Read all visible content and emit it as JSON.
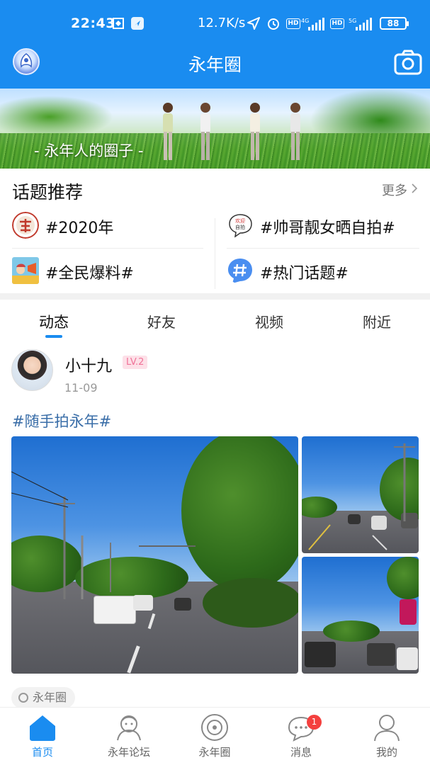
{
  "status_bar": {
    "time": "22:43",
    "network_speed": "12.7K/s",
    "battery": "88",
    "signal_labels": [
      "4G",
      "5G"
    ],
    "hd_label": "HD"
  },
  "header": {
    "title": "永年圈",
    "logo_icon": "app-logo-icon",
    "camera_icon": "camera-icon"
  },
  "banner": {
    "caption": "- 永年人的圈子 -"
  },
  "topics": {
    "title": "话题推荐",
    "more_label": "更多",
    "items": [
      {
        "label": "#2020年",
        "icon": "topic-2020-icon"
      },
      {
        "label": "#帅哥靓女晒自拍#",
        "icon": "topic-selfie-icon"
      },
      {
        "label": "#全民爆料#",
        "icon": "topic-report-icon"
      },
      {
        "label": "#热门话题#",
        "icon": "topic-hot-icon"
      }
    ]
  },
  "tabs": [
    {
      "label": "动态",
      "active": true
    },
    {
      "label": "好友",
      "active": false
    },
    {
      "label": "视频",
      "active": false
    },
    {
      "label": "附近",
      "active": false
    }
  ],
  "post": {
    "username": "小十九",
    "level": "LV.2",
    "date": "11-09",
    "hashtag": "#随手拍永年#",
    "circle_tag": "永年圈"
  },
  "bottom_nav": [
    {
      "label": "首页",
      "icon": "home-icon",
      "active": true
    },
    {
      "label": "永年论坛",
      "icon": "forum-icon",
      "active": false
    },
    {
      "label": "永年圈",
      "icon": "circle-icon",
      "active": false
    },
    {
      "label": "消息",
      "icon": "message-icon",
      "active": false,
      "badge": "1"
    },
    {
      "label": "我的",
      "icon": "profile-icon",
      "active": false
    }
  ],
  "colors": {
    "primary": "#1a8cf0",
    "badge": "#f4403e",
    "level_bg": "#fde0e8",
    "level_text": "#f07298",
    "hashtag": "#3a6ea8"
  }
}
